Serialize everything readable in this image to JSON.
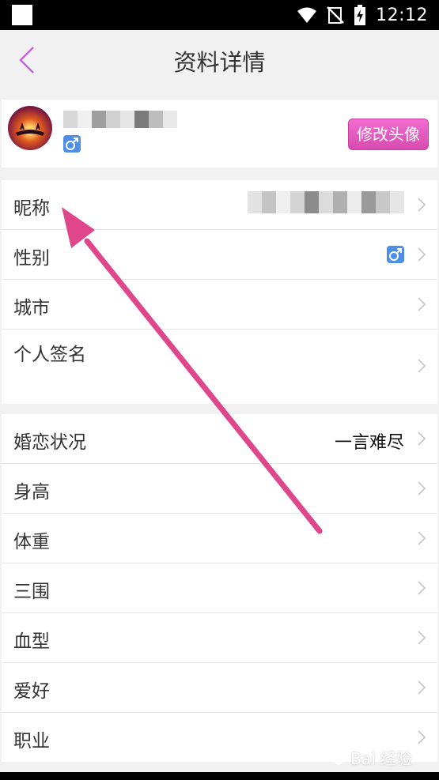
{
  "status_bar": {
    "time": "12:12"
  },
  "header": {
    "title": "资料详情"
  },
  "profile": {
    "change_avatar_label": "修改头像",
    "gender_symbol": "♂"
  },
  "sections": {
    "basic": [
      {
        "label": "昵称"
      },
      {
        "label": "性别",
        "gender_symbol": "♂"
      },
      {
        "label": "城市"
      },
      {
        "label": "个人签名"
      }
    ],
    "details": [
      {
        "label": "婚恋状况",
        "value": "一言难尽"
      },
      {
        "label": "身高"
      },
      {
        "label": "体重"
      },
      {
        "label": "三围"
      },
      {
        "label": "血型"
      },
      {
        "label": "爱好"
      },
      {
        "label": "职业"
      }
    ]
  },
  "watermark": {
    "text": "Bai 经验"
  },
  "colors": {
    "accent": "#e0468b",
    "gender_blue": "#4d8ee6",
    "button_pink": "#e55bc3",
    "back_purple": "#c166e0"
  }
}
